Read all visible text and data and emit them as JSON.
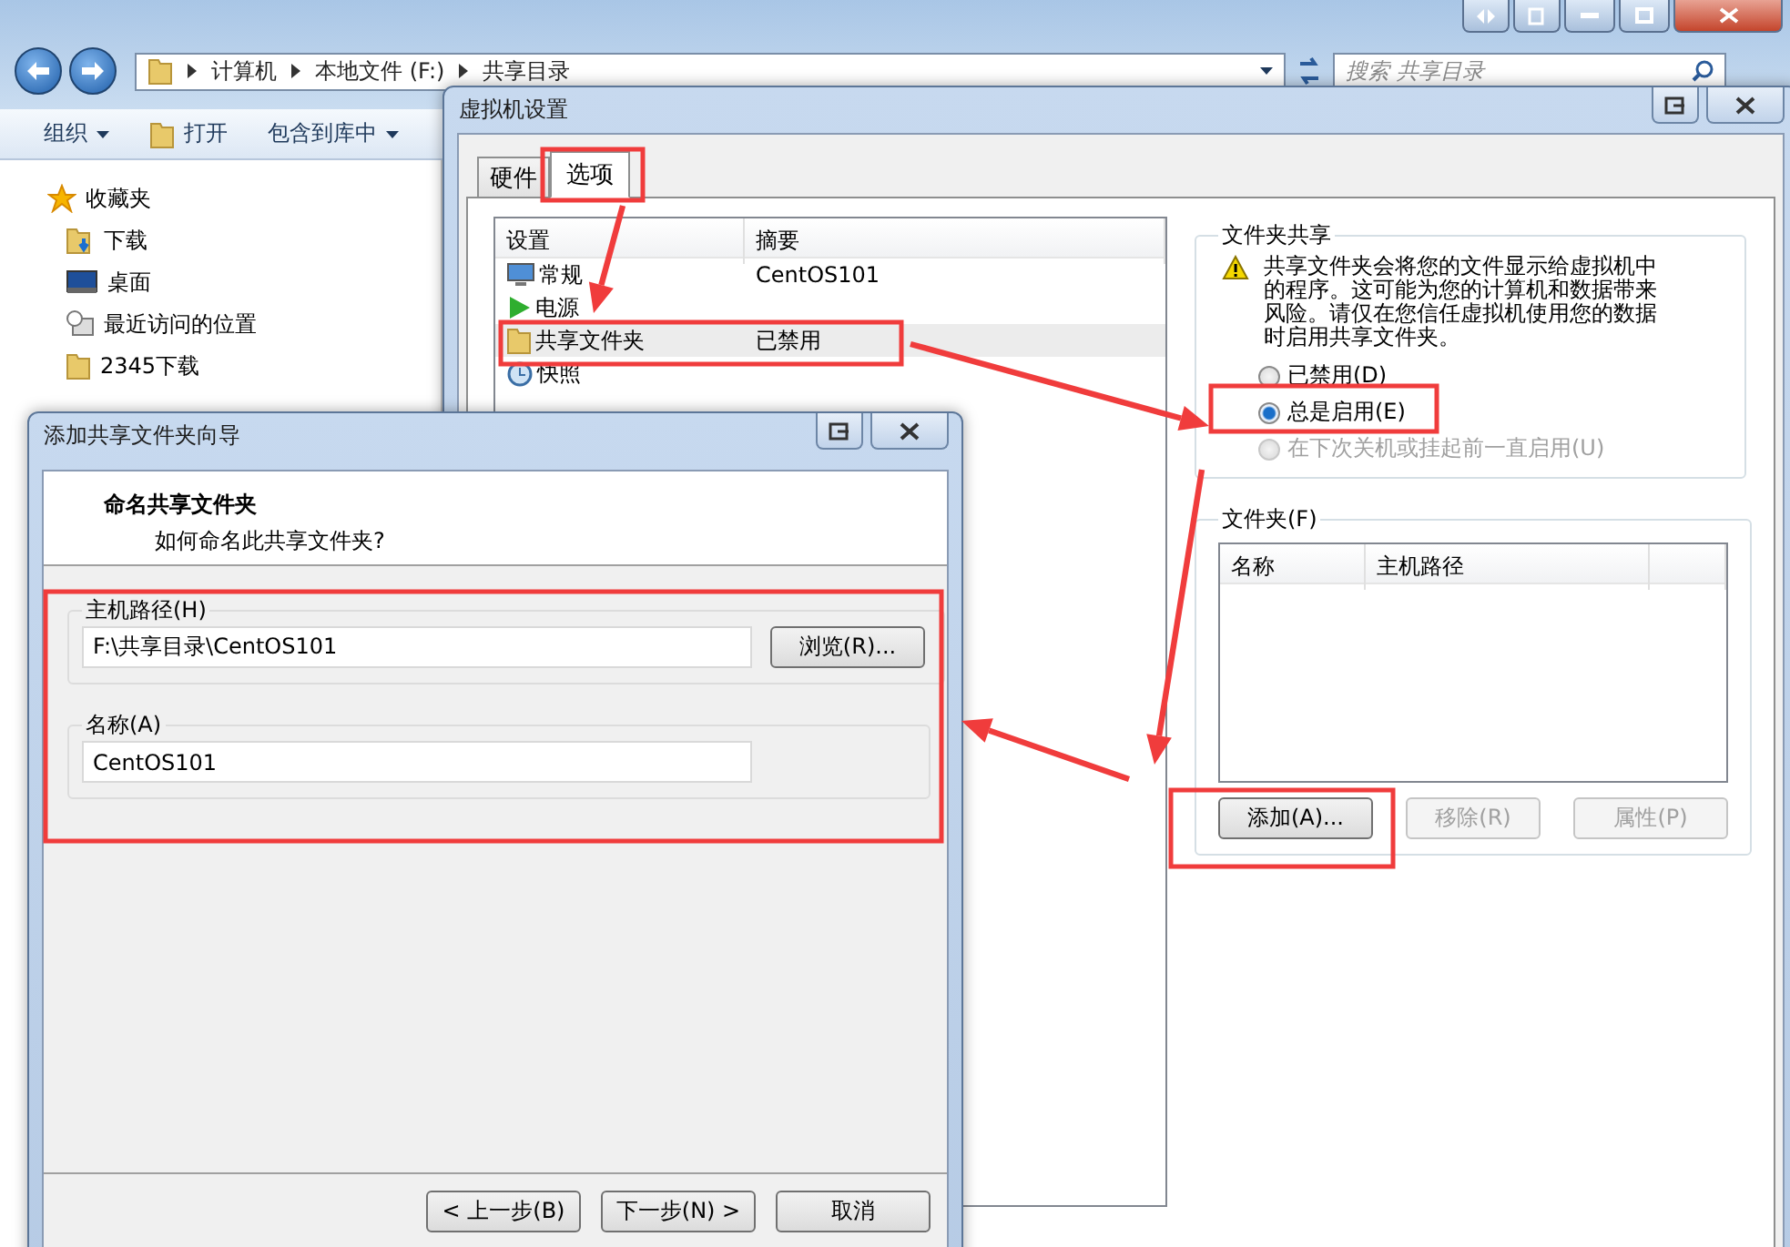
{
  "explorer": {
    "address_path": [
      "计算机",
      "本地文件 (F:)",
      "共享目录"
    ],
    "search": {
      "placeholder": "搜索 共享目录"
    },
    "toolbar": [
      {
        "label": "组织",
        "kind": "menu",
        "dropdown": true
      },
      {
        "label": "打开",
        "kind": "open",
        "dropdown": false
      },
      {
        "label": "包含到库中",
        "kind": "menu",
        "dropdown": true
      }
    ],
    "nav_items": [
      {
        "label": "收藏夹",
        "kind": "favorites"
      },
      {
        "label": "下载",
        "kind": "downloads"
      },
      {
        "label": "桌面",
        "kind": "desktop"
      },
      {
        "label": "最近访问的位置",
        "kind": "recent"
      },
      {
        "label": "2345下载",
        "kind": "folder"
      }
    ]
  },
  "vm_settings": {
    "title": "虚拟机设置",
    "tabs": [
      {
        "label": "硬件",
        "selected": false
      },
      {
        "label": "选项",
        "selected": true
      }
    ],
    "settings_list": {
      "columns": [
        "设置",
        "摘要"
      ],
      "rows": [
        {
          "name": "常规",
          "summary": "CentOS101",
          "kind": "general",
          "selected": false
        },
        {
          "name": "电源",
          "kind": "power",
          "selected": false
        },
        {
          "name": "共享文件夹",
          "summary": "已禁用",
          "kind": "shared",
          "selected": true
        },
        {
          "name": "快照",
          "kind": "snapshot",
          "selected": false
        }
      ]
    },
    "folder_sharing": {
      "title": "文件夹共享",
      "warning": "共享文件夹会将您的文件显示给虚拟机中的程序。这可能为您的计算机和数据带来风险。请仅在您信任虚拟机使用您的数据时启用共享文件夹。",
      "options": [
        {
          "label": "已禁用(D)",
          "selected": false,
          "disabled": false
        },
        {
          "label": "总是启用(E)",
          "selected": true,
          "disabled": false
        },
        {
          "label": "在下次关机或挂起前一直启用(U)",
          "selected": false,
          "disabled": true
        }
      ]
    },
    "folders": {
      "title": "文件夹(F)",
      "columns": [
        "名称",
        "主机路径"
      ],
      "buttons": [
        {
          "label": "添加(A)...",
          "disabled": false
        },
        {
          "label": "移除(R)",
          "disabled": true
        },
        {
          "label": "属性(P)",
          "disabled": true
        }
      ]
    }
  },
  "wizard": {
    "title": "添加共享文件夹向导",
    "heading": "命名共享文件夹",
    "subheading": "如何命名此共享文件夹?",
    "host_path": {
      "label": "主机路径(H)",
      "value": "F:\\共享目录\\CentOS101",
      "button": "浏览(R)..."
    },
    "name": {
      "label": "名称(A)",
      "value": "CentOS101"
    },
    "buttons": [
      {
        "label": "< 上一步(B)"
      },
      {
        "label": "下一步(N) >"
      },
      {
        "label": "取消"
      }
    ]
  }
}
